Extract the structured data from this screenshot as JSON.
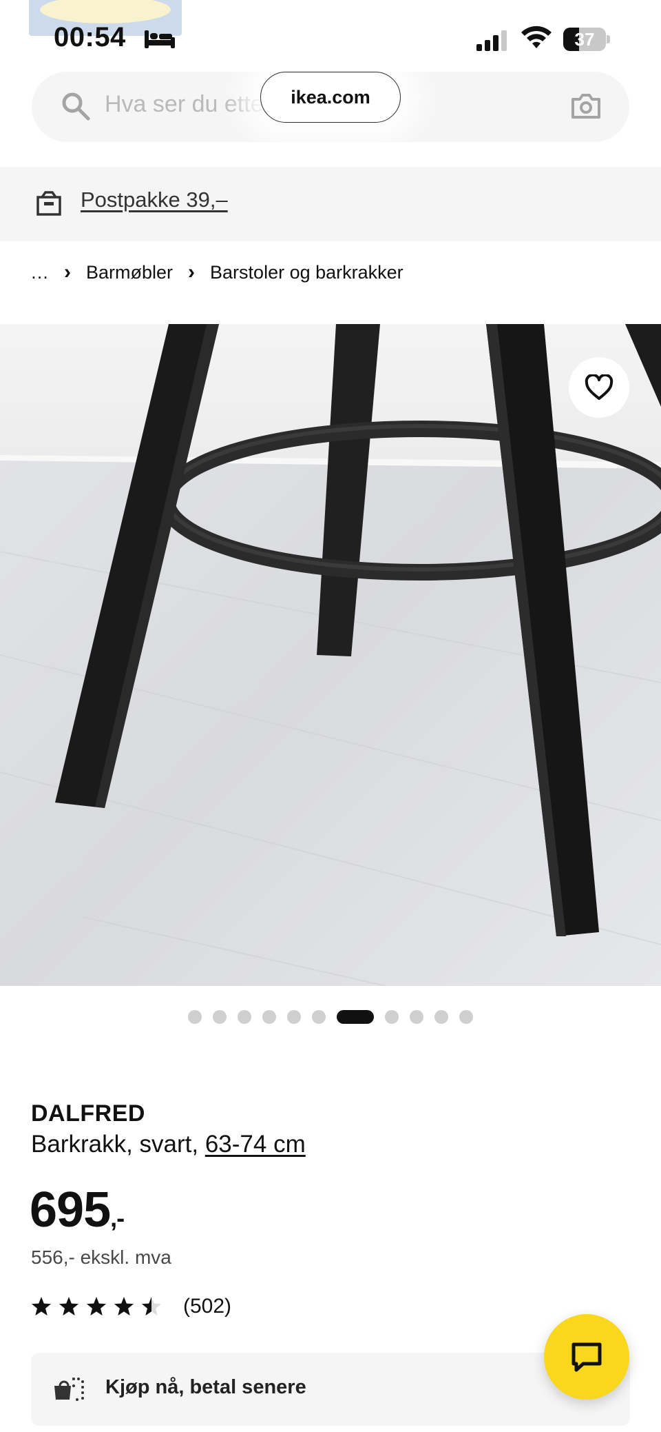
{
  "status_bar": {
    "time": "00:54",
    "battery_percent": "37",
    "battery_level": 0.37
  },
  "search": {
    "placeholder": "Hva ser du etter?",
    "url": "ikea.com"
  },
  "delivery_banner": {
    "label": "Postpakke 39,–",
    "icon": "parcel-icon"
  },
  "breadcrumb": {
    "items": [
      "…",
      "Barmøbler",
      "Barstoler og barkrakker"
    ]
  },
  "gallery": {
    "total_images": 11,
    "active_index": 6,
    "favorite_icon": "heart-icon"
  },
  "product": {
    "name": "DALFRED",
    "description": "Barkrakk, svart, ",
    "size": "63-74 cm",
    "price": "695",
    "price_suffix": ",-",
    "price_ex_vat": "556,- ekskl. mva",
    "rating": 4.5,
    "review_count": "(502)"
  },
  "pay_later": {
    "label": "Kjøp nå, betal senere",
    "icon": "installment-icon"
  },
  "chat": {
    "icon": "chat-icon"
  },
  "colors": {
    "ikea_yellow": "#f9d71c",
    "banner_bg": "#f5f5f5",
    "text": "#111111"
  }
}
